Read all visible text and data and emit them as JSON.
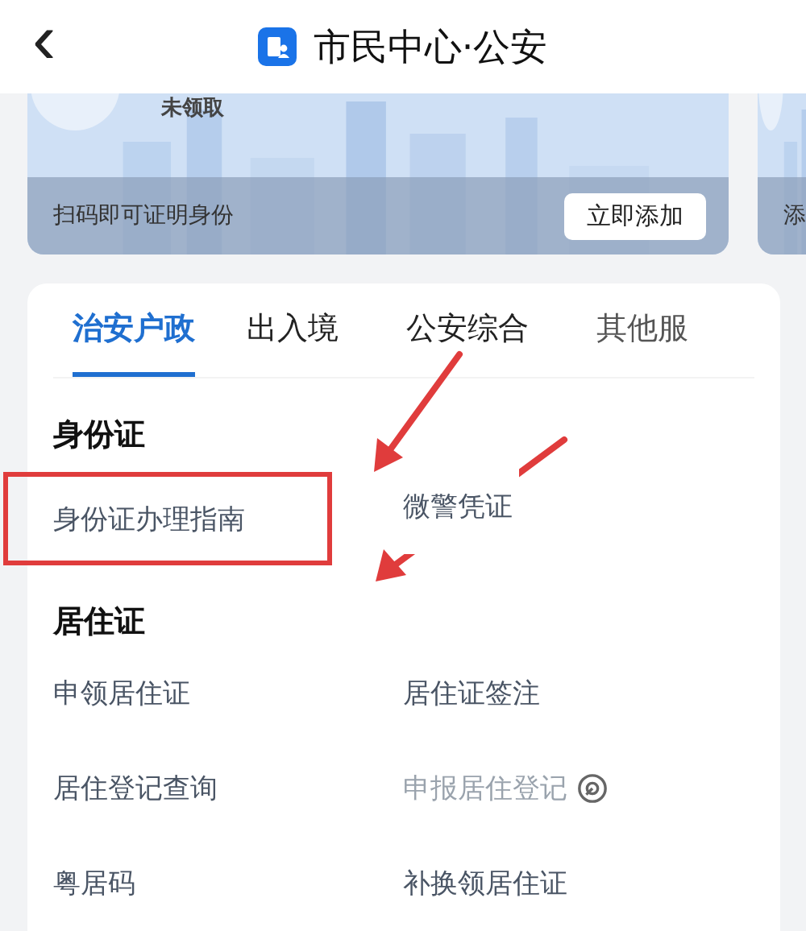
{
  "header": {
    "back_icon": "‹",
    "title": "市民中心·公安"
  },
  "cards": [
    {
      "status": "未领取",
      "caption": "扫码即可证明身份",
      "button": "立即添加"
    },
    {
      "caption": "添"
    }
  ],
  "tabs": [
    {
      "label": "治安户政",
      "selected": true
    },
    {
      "label": "出入境",
      "selected": false
    },
    {
      "label": "公安综合",
      "selected": false
    },
    {
      "label": "其他服",
      "selected": false
    }
  ],
  "sections": [
    {
      "title": "身份证",
      "items": [
        {
          "label": "身份证办理指南",
          "disabled": false,
          "highlighted": true
        },
        {
          "label": "微警凭证",
          "disabled": false,
          "highlighted": false
        }
      ]
    },
    {
      "title": "居住证",
      "items": [
        {
          "label": "申领居住证",
          "disabled": false,
          "highlighted": false
        },
        {
          "label": "居住证签注",
          "disabled": false,
          "highlighted": false
        },
        {
          "label": "居住登记查询",
          "disabled": false,
          "highlighted": false
        },
        {
          "label": "申报居住登记",
          "disabled": true,
          "highlighted": false
        },
        {
          "label": "粤居码",
          "disabled": false,
          "highlighted": false
        },
        {
          "label": "补换领居住证",
          "disabled": false,
          "highlighted": false
        }
      ]
    }
  ]
}
